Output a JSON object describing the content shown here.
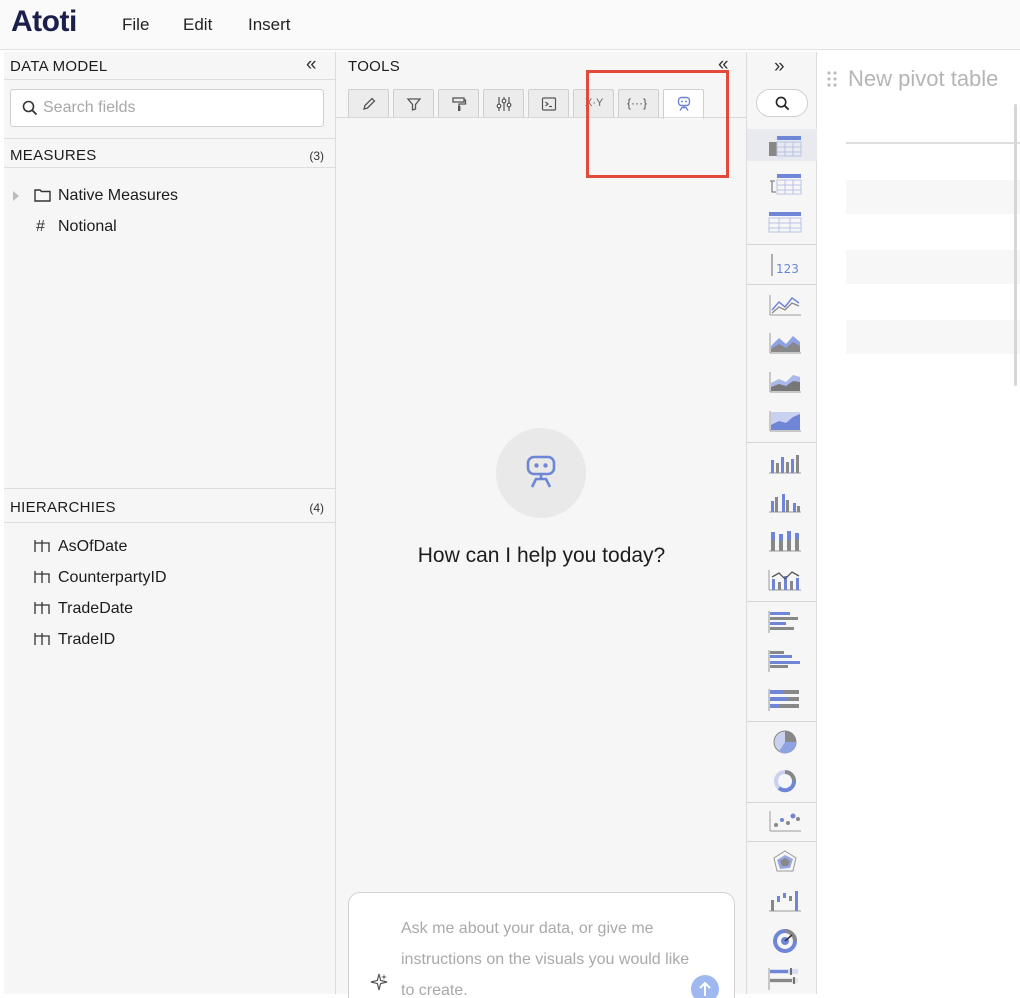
{
  "app": {
    "logo": "Atoti",
    "menu": [
      "File",
      "Edit",
      "Insert"
    ]
  },
  "data_model": {
    "title": "DATA MODEL",
    "search_placeholder": "Search fields",
    "measures": {
      "title": "MEASURES",
      "count": "(3)",
      "items": [
        {
          "label": "Native Measures",
          "icon": "folder-icon"
        },
        {
          "label": "Notional",
          "icon": "hash-icon"
        }
      ]
    },
    "hierarchies": {
      "title": "HIERARCHIES",
      "count": "(4)",
      "items": [
        "AsOfDate",
        "CounterpartyID",
        "TradeDate",
        "TradeID"
      ]
    }
  },
  "tools": {
    "title": "TOOLS",
    "tabs": [
      "pencil-icon",
      "filter-icon",
      "paint-roller-icon",
      "sliders-icon",
      "terminal-icon",
      "xy-icon",
      "braces-icon",
      "robot-icon"
    ],
    "active_tab": "robot-icon",
    "xy_label": "X·Y",
    "braces_label": "{···}",
    "greeting": "How can I help you today?",
    "chat_placeholder": "Ask me about your data, or give me instructions on the visuals you would like to create.",
    "highlight_color": "#e24a3b"
  },
  "widgets": {
    "icons": [
      "pivot-table-icon",
      "tree-table-icon",
      "table-icon",
      "kpi-icon",
      "line-chart-icon",
      "area-chart-icon",
      "stacked-area-icon",
      "percent-area-icon",
      "column-chart-icon",
      "clustered-column-icon",
      "stacked-column-icon",
      "combo-chart-icon",
      "bar-chart-icon",
      "clustered-bar-icon",
      "stacked-bar-icon",
      "pie-chart-icon",
      "donut-chart-icon",
      "scatter-plot-icon",
      "radar-chart-icon",
      "waterfall-icon",
      "gauge-icon",
      "bullet-chart-icon"
    ],
    "kpi_label": "123",
    "accent": "#6f86d6"
  },
  "canvas": {
    "title": "New pivot table"
  }
}
